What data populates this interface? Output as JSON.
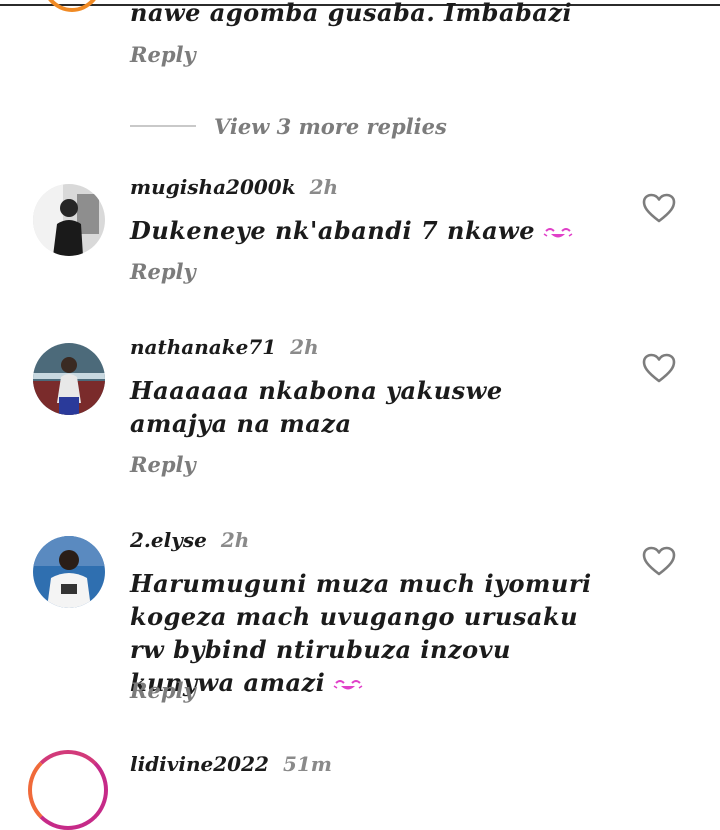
{
  "top_comment": {
    "text": "nawe agomba gusaba. Imbabazi",
    "reply_label": "Reply"
  },
  "view_more": {
    "label": "View 3 more replies"
  },
  "comments": [
    {
      "username": "mugisha2000k",
      "time": "2h",
      "text": "Dukeneye nk'abandi 7 nkawe",
      "reply_label": "Reply",
      "emoji": "laughing-emoji"
    },
    {
      "username": "nathanake71",
      "time": "2h",
      "text": "Haaaaaa nkabona yakuswe amajya na maza",
      "reply_label": "Reply"
    },
    {
      "username": "2.elyse",
      "time": "2h",
      "text": "Harumuguni muza much iyomuri kogeza mach  uvugango  urusaku  rw bybind ntirubuza inzovu kunywa amazi",
      "reply_label": "Reply",
      "emoji": "laughing-emoji"
    }
  ],
  "bottom_comment": {
    "username": "lidivine2022",
    "time": "51m"
  },
  "colors": {
    "emoji": "#e040c8",
    "time": "#8a8a8a",
    "reply": "#7c7c7c",
    "story_ring_orange": "#f08a24",
    "story_ring_magenta": "#c62a88"
  }
}
